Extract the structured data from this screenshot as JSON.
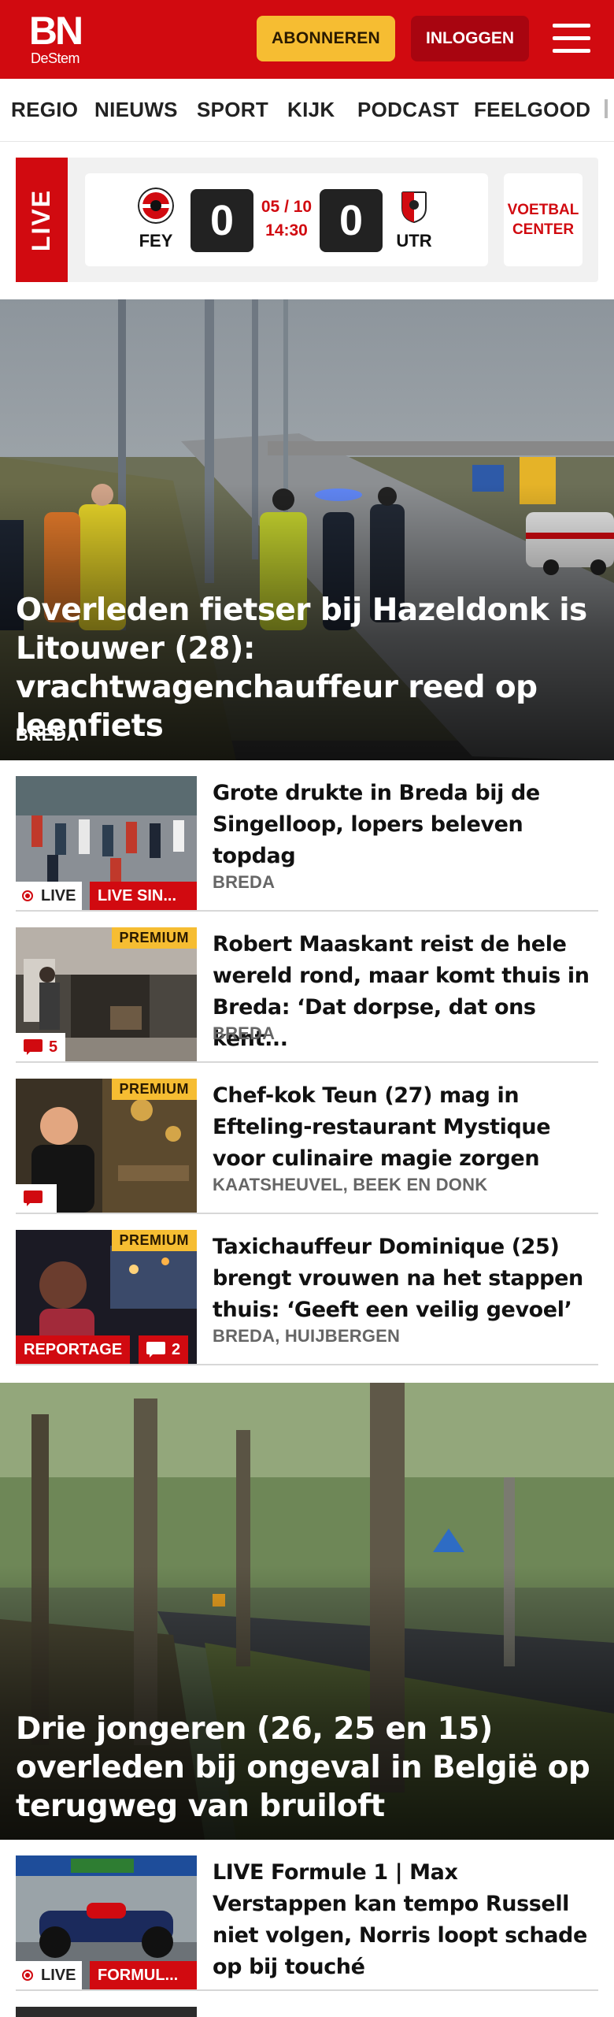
{
  "header": {
    "logo_main": "BN",
    "logo_sub": "DeStem",
    "subscribe_label": "ABONNEREN",
    "login_label": "INLOGGEN",
    "menu_icon": "hamburger-menu-icon",
    "brand_color": "#d10a10",
    "accent_color": "#f6bd32"
  },
  "nav": {
    "items": [
      "REGIO",
      "NIEUWS",
      "SPORT",
      "KIJK",
      "PODCAST",
      "FEELGOOD"
    ]
  },
  "live_widget": {
    "tag": "LIVE",
    "home_team": "FEY",
    "away_team": "UTR",
    "home_score": "0",
    "away_score": "0",
    "date": "05 / 10",
    "time": "14:30",
    "center_label": "VOETBAL CENTER"
  },
  "hero1": {
    "title": "Overleden fietser bij Hazeldonk is Litouwer (28): vrachtwagenchauffeur reed op leenfiets",
    "location": "BREDA"
  },
  "articles": [
    {
      "title": "Grote drukte in Breda bij de Singelloop, lopers beleven topdag",
      "location": "BREDA",
      "live_label": "LIVE",
      "tag": "LIVE SIN..."
    },
    {
      "title": "Robert Maaskant reist de hele wereld rond, maar komt thuis in Breda: ‘Dat dorpse, dat ons kent...",
      "location": "BREDA",
      "premium": "PREMIUM",
      "comments": "5"
    },
    {
      "title": "Chef-kok Teun (27) mag in Efteling-restaurant Mystique voor culinaire magie zorgen",
      "location": "KAATSHEUVEL, BEEK EN DONK",
      "premium": "PREMIUM"
    },
    {
      "title": "Taxichauffeur Dominique (25) brengt vrouwen na het stappen thuis: ‘Geeft een veilig gevoel’",
      "location": "BREDA, HUIJBERGEN",
      "premium": "PREMIUM",
      "tag": "REPORTAGE",
      "comments": "2"
    },
    {
      "title": "LIVE Formule 1 | Max Verstappen kan tempo Russell niet volgen, Norris loopt schade op bij touché",
      "live_label": "LIVE",
      "tag": "FORMUL..."
    }
  ],
  "hero2": {
    "title": "Drie jongeren (26, 25 en 15) overleden bij ongeval in België op terugweg van bruiloft"
  }
}
